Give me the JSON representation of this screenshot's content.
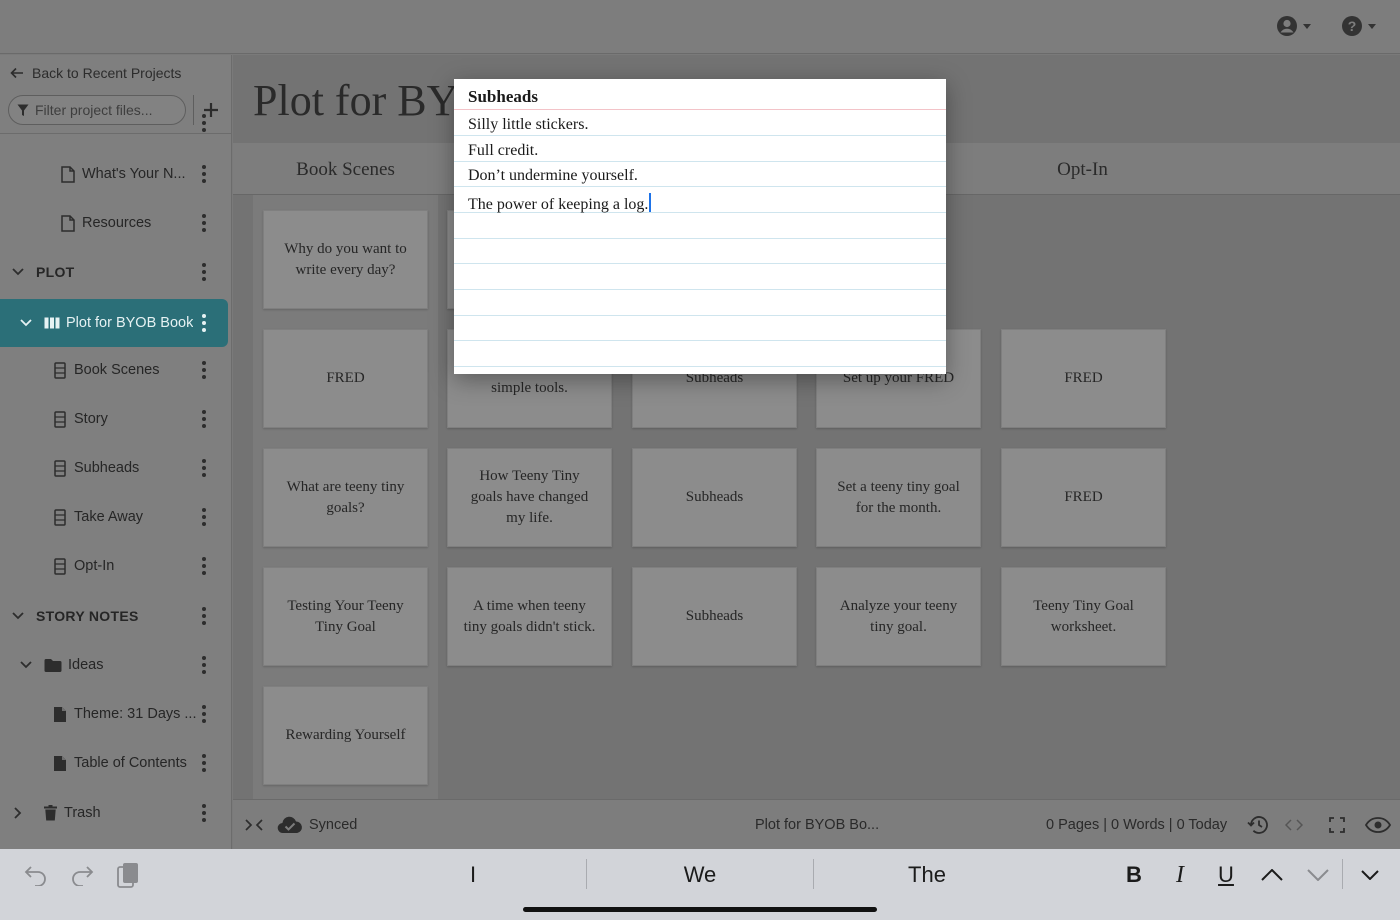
{
  "topbar": {
    "account_icon": "account-circle-icon",
    "help_icon": "help-circle-icon"
  },
  "sidebar": {
    "back_label": "Back to Recent Projects",
    "filter_placeholder": "Filter project files...",
    "items": [
      {
        "label": "What's Your N...",
        "icon": "document-icon",
        "level": 2
      },
      {
        "label": "Resources",
        "icon": "document-icon",
        "level": 2
      },
      {
        "label": "PLOT",
        "icon": "chevron-down-icon",
        "level": 0
      },
      {
        "label": "Plot for BYOB Book",
        "icon": "board-icon",
        "level": 1,
        "active": true
      },
      {
        "label": "Book Scenes",
        "icon": "column-icon",
        "level": 2
      },
      {
        "label": "Story",
        "icon": "column-icon",
        "level": 2
      },
      {
        "label": "Subheads",
        "icon": "column-icon",
        "level": 2
      },
      {
        "label": "Take Away",
        "icon": "column-icon",
        "level": 2
      },
      {
        "label": "Opt-In",
        "icon": "column-icon",
        "level": 2
      },
      {
        "label": "STORY NOTES",
        "icon": "chevron-down-icon",
        "level": 0
      },
      {
        "label": "Ideas",
        "icon": "folder-icon",
        "level": 1
      },
      {
        "label": "Theme: 31 Days ...",
        "icon": "note-icon",
        "level": 2
      },
      {
        "label": "Table of Contents",
        "icon": "note-icon",
        "level": 2
      },
      {
        "label": "Trash",
        "icon": "trash-icon",
        "level": 0
      }
    ]
  },
  "main": {
    "title": "Plot for BY",
    "columns": [
      "Book Scenes",
      "Opt-In"
    ],
    "cards": {
      "r1": [
        "Why do you want to write every day?"
      ],
      "r2": [
        "FRED",
        "simple tools.",
        "Subheads",
        "Set up your FRED",
        "FRED"
      ],
      "r3": [
        "What are teeny tiny goals?",
        "How Teeny Tiny goals have changed my life.",
        "Subheads",
        "Set a teeny tiny goal for the month.",
        "FRED"
      ],
      "r4": [
        "Testing Your Teeny Tiny Goal",
        "A time when teeny tiny goals didn't stick.",
        "Subheads",
        "Analyze your teeny tiny goal.",
        "Teeny Tiny Goal worksheet."
      ],
      "r5": [
        "Rewarding Yourself"
      ]
    }
  },
  "popup": {
    "title": "Subheads",
    "lines": [
      "Silly little stickers.",
      "Full credit.",
      "Don’t undermine yourself.",
      "The power of keeping a log."
    ]
  },
  "statusbar": {
    "sync_label": "Synced",
    "doc_name": "Plot for BYOB Bo...",
    "stats": "0 Pages | 0 Words | 0 Today"
  },
  "keyboard": {
    "suggestions": [
      "I",
      "We",
      "The"
    ],
    "bold": "B",
    "italic": "I",
    "underline": "U"
  }
}
